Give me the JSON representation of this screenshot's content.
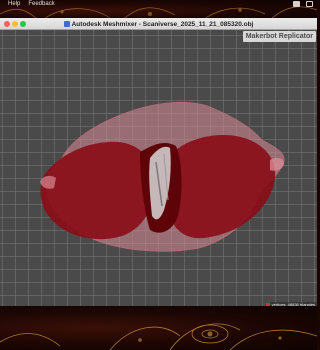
{
  "menubar": {
    "items": [
      "Help",
      "Feedback"
    ]
  },
  "window": {
    "title": "Autodesk Meshmixer - Scaniverse_2025_11_21_085320.obj",
    "app_icon": "meshmixer-app-icon"
  },
  "viewport": {
    "printer_label": "Makerbot Replicator",
    "status_text": "vertices: 48836 triangles",
    "grid": true,
    "model_colors": {
      "bed_outline": "#d98a95",
      "model_main": "#8a0c16",
      "model_dark": "#5e0409",
      "highlight": "#e8e8e8"
    }
  },
  "colors": {
    "viewport_bg": "#4a4a4a",
    "titlebar_bg": "#e2e2e2",
    "label_bg": "#d8d8d8"
  }
}
